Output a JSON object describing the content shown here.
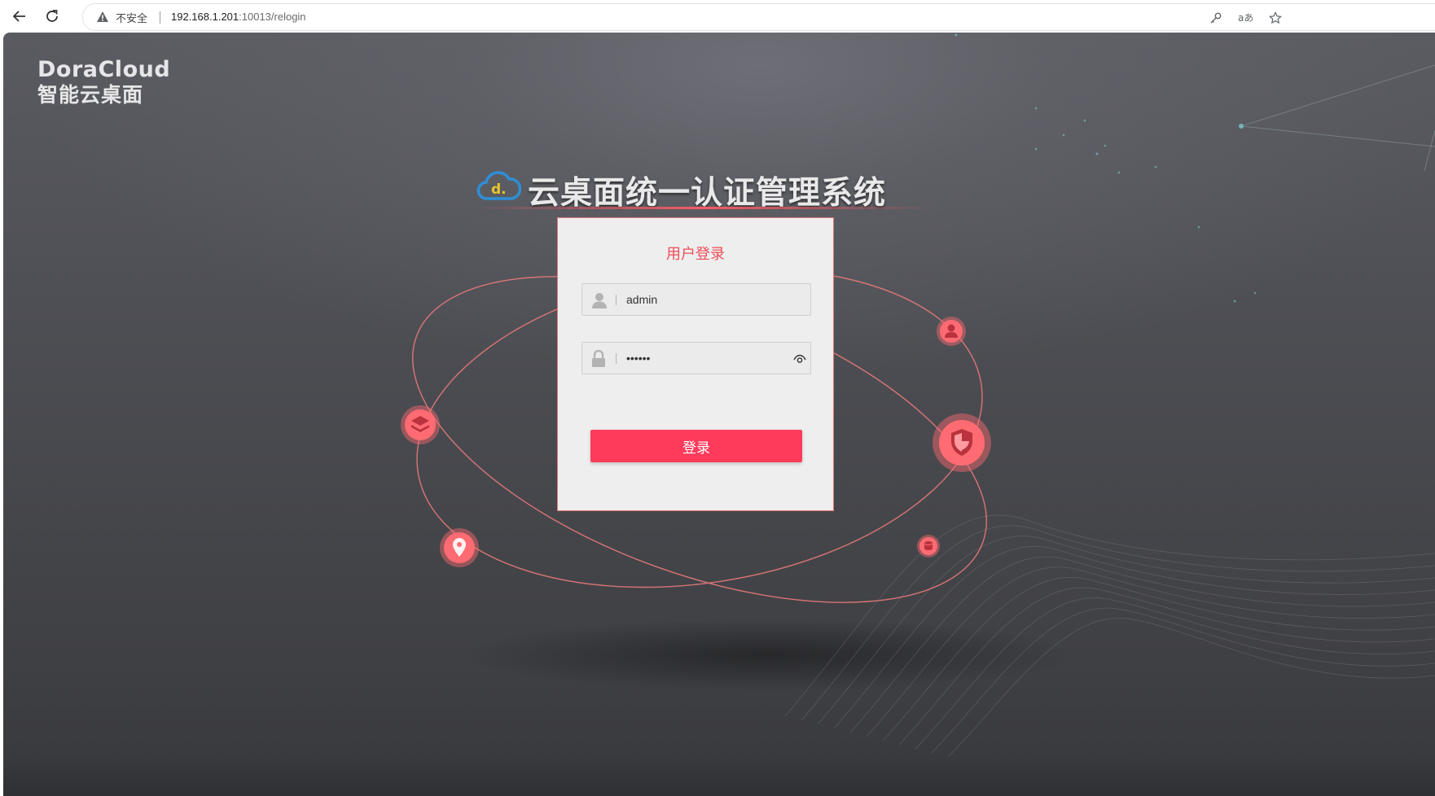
{
  "browser": {
    "security_label": "不安全",
    "url_host": "192.168.1.201",
    "url_rest": ":10013/relogin"
  },
  "page": {
    "brand_name": "DoraCloud",
    "brand_subtitle": "智能云桌面",
    "logo_letter": "d.",
    "system_title": "云桌面统一认证管理系统"
  },
  "login": {
    "title": "用户登录",
    "username_value": "admin",
    "password_value": "••••••",
    "submit_label": "登录"
  },
  "colors": {
    "accent": "#ff3b5c",
    "title_red": "#ee4d5a",
    "orbit": "#e87a7a",
    "node": "#ff6b72"
  },
  "icons": [
    "back-arrow-icon",
    "reload-icon",
    "warning-icon",
    "key-icon",
    "translate-icon",
    "star-icon",
    "cloud-logo-icon",
    "user-icon",
    "lock-icon",
    "eye-icon",
    "layers-icon",
    "location-pin-icon",
    "person-node-icon",
    "shield-icon",
    "database-icon"
  ]
}
